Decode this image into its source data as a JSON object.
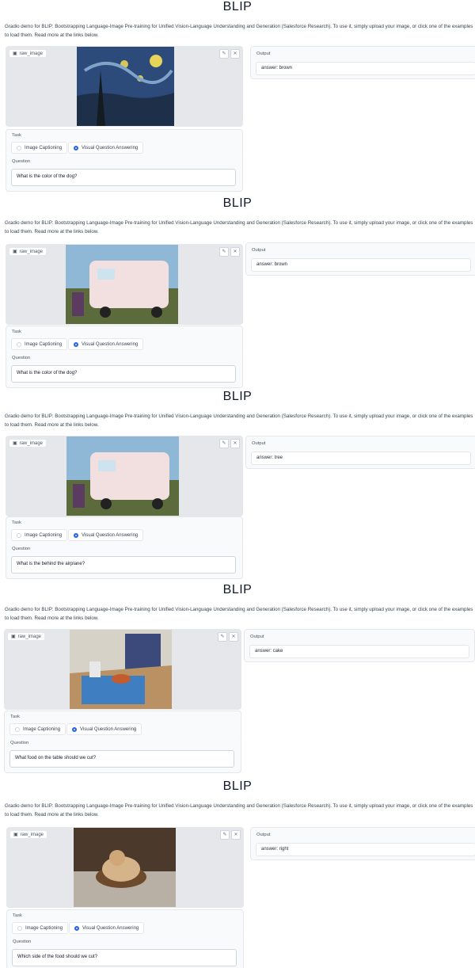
{
  "title": "BLIP",
  "description": "Gradio demo for BLIP: Bootstrapping Language-Image Pre-training for Unified Vision-Language Understanding and Generation (Salesforce Research). To use it, simply upload your image, or click one of the examples to load them. Read more at the links below.",
  "image_label": "raw_image",
  "task_label": "Task",
  "task_options": [
    "Image Captioning",
    "Visual Question Answering"
  ],
  "selected_task": "Visual Question Answering",
  "question_label": "Question",
  "output_label": "Output",
  "icons": {
    "image": "image-icon",
    "edit": "pencil-icon",
    "clear": "close-icon"
  },
  "colors": {
    "accent": "#2563eb",
    "panel": "#f9fafb",
    "border": "#e5e7eb"
  },
  "panels": [
    {
      "question": "What is the color of the dog?",
      "answer": "answer: brown",
      "image": "starry-night-painting"
    },
    {
      "question": "What is the color of the dog?",
      "answer": "answer: brown",
      "image": "pink-vw-food-truck"
    },
    {
      "question": "What is the behind the airplane?",
      "answer": "answer: tree",
      "image": "pink-vw-food-truck"
    },
    {
      "question": "What food on the table should we cut?",
      "answer": "answer: cake",
      "image": "kitchen-table-cake"
    },
    {
      "question": "Which side of the food should we cut?",
      "answer": "answer: right",
      "image": "cat-in-bowl"
    }
  ]
}
